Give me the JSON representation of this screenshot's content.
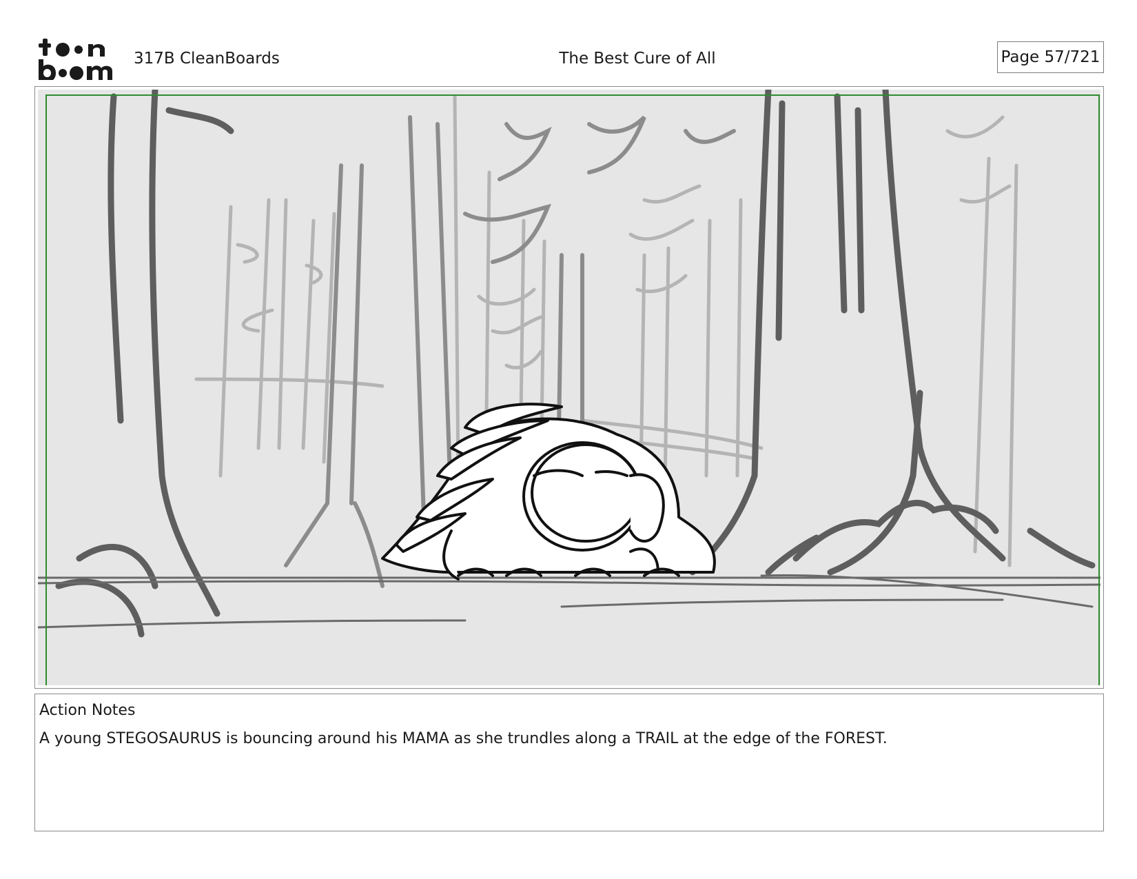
{
  "header": {
    "logo_text": "toon boom",
    "scene": "317B  CleanBoards",
    "title": "The Best Cure of All",
    "page": "Page  57/721"
  },
  "panel": {
    "image_alt": "",
    "safe_frame_color": "#2e8b2e"
  },
  "notes": {
    "title": "Action Notes",
    "body": "A young STEGOSAURUS is bouncing around his MAMA as she trundles along a TRAIL at the edge of the FOREST."
  }
}
